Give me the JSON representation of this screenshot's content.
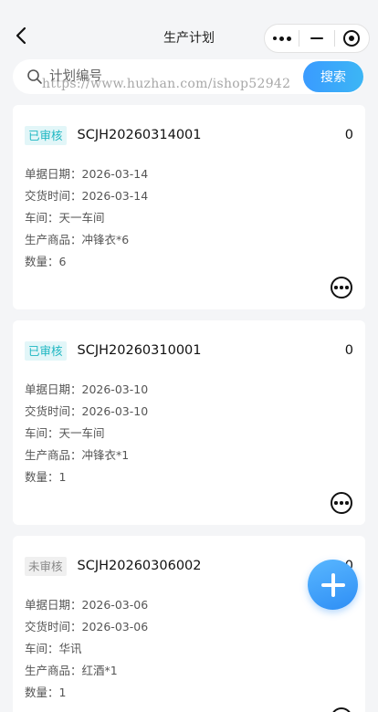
{
  "nav": {
    "title": "生产计划",
    "back_icon": "chevron-left-icon",
    "capsule_icons": [
      "more-dots-icon",
      "minimize-icon",
      "close-target-icon"
    ]
  },
  "search": {
    "placeholder": "计划编号",
    "button_label": "搜索",
    "watermark": "https://www.huzhan.com/ishop52942"
  },
  "plans": [
    {
      "status": "已审核",
      "status_type": "approved",
      "code": "SCJH20260314001",
      "count": "0",
      "fields": [
        "单据日期：2026-03-14",
        "交货时间：2026-03-14",
        "车间：天一车间",
        "生产商品：冲锋衣*6",
        "数量：6"
      ]
    },
    {
      "status": "已审核",
      "status_type": "approved",
      "code": "SCJH20260310001",
      "count": "0",
      "fields": [
        "单据日期：2026-03-10",
        "交货时间：2026-03-10",
        "车间：天一车间",
        "生产商品：冲锋衣*1",
        "数量：1"
      ]
    },
    {
      "status": "未审核",
      "status_type": "pending",
      "code": "SCJH20260306002",
      "count": "0",
      "fields": [
        "单据日期：2026-03-06",
        "交货时间：2026-03-06",
        "车间：华讯",
        "生产商品：红酒*1",
        "数量：1"
      ]
    }
  ],
  "fab_icon": "plus-icon",
  "colors": {
    "accent": "#3a9bff",
    "approved_text": "#1fb7c2",
    "approved_bg": "#e2f6f8",
    "pending_text": "#888888",
    "pending_bg": "#f0f0f0",
    "page_bg": "#f4f5f7"
  }
}
